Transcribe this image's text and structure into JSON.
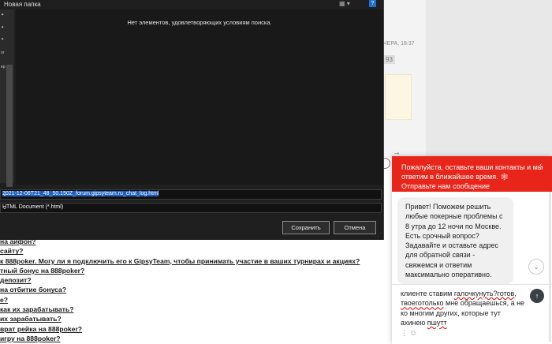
{
  "dialog": {
    "title": "Новая папка",
    "empty_message": "Нет элементов, удовлетворяющих условиям поиска.",
    "nav_items": [
      "",
      "",
      "",
      "ог",
      "ер",
      "",
      "",
      "",
      ""
    ],
    "filename_value": "2021-12-06T21_48_50.150Z_forum.gipsyteam.ru_chat_log.html",
    "filetype_value": "HTML Document (*.html)",
    "save_label": "Сохранить",
    "cancel_label": "Отмена"
  },
  "page": {
    "timestamp": "ЧЕРА, 18:37",
    "tag": "93",
    "arrow": "→",
    "links": [
      "на айфон?",
      "сайту?",
      "к 888poker. Могу ли я подключить его к GipsyTeam, чтобы принимать участие в ваших турнирах и акциях?",
      "тный бонус на 888poker?",
      "депозит?",
      "на отбитие бонуса?",
      "е?",
      "как их зарабатывать?",
      "их зарабатывать?",
      "врат рейка на 888poker?",
      "игру на 888poker?"
    ]
  },
  "chat": {
    "header": "Пожалуйста, оставьте ваши контакты и мы ответим в ближайшее время.",
    "header_suffix": "Отправьте нам сообщение",
    "header_emoji": "🕸",
    "close_icon": "‹",
    "bubble": "Привет! Поможем решить любые покерные проблемы с 8 утра до 12 ночи по Москве. Есть срочный вопрос? Задавайте и оставьте адрес для обратной связи - свяжемся и ответим максимально оперативно.",
    "compose_pre": "клиенте ставим ",
    "compose_w1": "галочкунуть?готов",
    "compose_mid": ", ",
    "compose_w2": "твоеготолько",
    "compose_post": " мне обращаешься, а не ко многим других, которые тут ахинею ",
    "compose_w3": "пшутт",
    "send_icon": "↑",
    "down_icon": "⌄",
    "menu_icon": "⋮",
    "emoji_icon": "☺"
  }
}
